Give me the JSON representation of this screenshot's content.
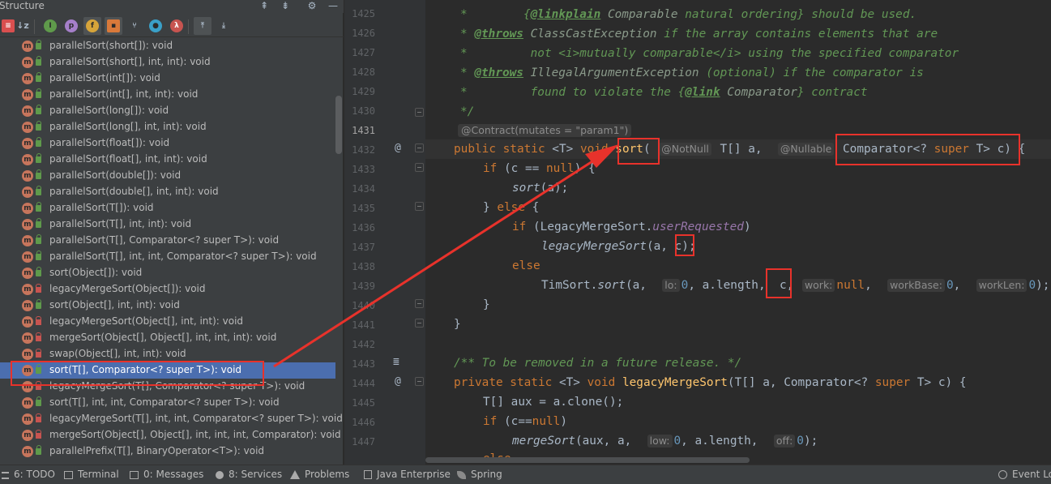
{
  "structure": {
    "title": "Structure",
    "items": [
      {
        "label": "parallelSort(short[]): void",
        "vis": "pub"
      },
      {
        "label": "parallelSort(short[], int, int): void",
        "vis": "pub"
      },
      {
        "label": "parallelSort(int[]): void",
        "vis": "pub"
      },
      {
        "label": "parallelSort(int[], int, int): void",
        "vis": "pub"
      },
      {
        "label": "parallelSort(long[]): void",
        "vis": "pub"
      },
      {
        "label": "parallelSort(long[], int, int): void",
        "vis": "pub"
      },
      {
        "label": "parallelSort(float[]): void",
        "vis": "pub"
      },
      {
        "label": "parallelSort(float[], int, int): void",
        "vis": "pub"
      },
      {
        "label": "parallelSort(double[]): void",
        "vis": "pub"
      },
      {
        "label": "parallelSort(double[], int, int): void",
        "vis": "pub"
      },
      {
        "label": "parallelSort(T[]): void",
        "vis": "pub"
      },
      {
        "label": "parallelSort(T[], int, int): void",
        "vis": "pub"
      },
      {
        "label": "parallelSort(T[], Comparator<? super T>): void",
        "vis": "pub"
      },
      {
        "label": "parallelSort(T[], int, int, Comparator<? super T>): void",
        "vis": "pub"
      },
      {
        "label": "sort(Object[]): void",
        "vis": "pub"
      },
      {
        "label": "legacyMergeSort(Object[]): void",
        "vis": "priv"
      },
      {
        "label": "sort(Object[], int, int): void",
        "vis": "pub"
      },
      {
        "label": "legacyMergeSort(Object[], int, int): void",
        "vis": "priv"
      },
      {
        "label": "mergeSort(Object[], Object[], int, int, int): void",
        "vis": "priv"
      },
      {
        "label": "swap(Object[], int, int): void",
        "vis": "priv"
      },
      {
        "label": "sort(T[], Comparator<? super T>): void",
        "vis": "pub",
        "selected": true
      },
      {
        "label": "legacyMergeSort(T[], Comparator<? super T>): void",
        "vis": "priv"
      },
      {
        "label": "sort(T[], int, int, Comparator<? super T>): void",
        "vis": "pub"
      },
      {
        "label": "legacyMergeSort(T[], int, int, Comparator<? super T>): void",
        "vis": "priv"
      },
      {
        "label": "mergeSort(Object[], Object[], int, int, int, Comparator): void",
        "vis": "priv"
      },
      {
        "label": "parallelPrefix(T[], BinaryOperator<T>): void",
        "vis": "pub"
      }
    ]
  },
  "editor": {
    "line_numbers": [
      "1425",
      "1426",
      "1427",
      "1428",
      "1429",
      "1430",
      "1431",
      "1432",
      "1433",
      "1434",
      "1435",
      "1436",
      "1437",
      "1438",
      "1439",
      "1440",
      "1441",
      "1442",
      "1443",
      "1444",
      "1445",
      "1446",
      "1447"
    ],
    "contract_hint": "@Contract(mutates = \"param1\")",
    "hints": {
      "notnull": "@NotNull",
      "nullable": "@Nullable",
      "lo": "lo:",
      "work": "work:",
      "workbase": "workBase:",
      "worklen": "workLen:",
      "low": "low:",
      "off": "off:"
    }
  },
  "bottombar": {
    "todo": "6: TODO",
    "terminal": "Terminal",
    "messages": "0: Messages",
    "services": "8: Services",
    "problems": "Problems",
    "java_enterprise": "Java Enterprise",
    "spring": "Spring",
    "event_log": "Event Log"
  },
  "colors": {
    "accent_red": "#e8322b",
    "selection": "#4b6eaf",
    "keyword": "#cc7832",
    "function": "#ffc66d",
    "doc": "#629755"
  }
}
